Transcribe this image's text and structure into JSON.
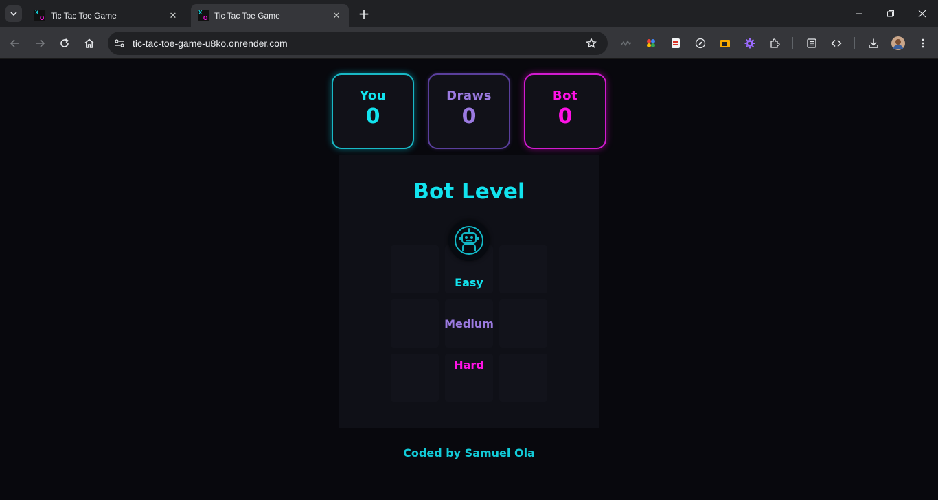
{
  "browser": {
    "tabs": [
      {
        "title": "Tic Tac Toe Game",
        "active": false
      },
      {
        "title": "Tic Tac Toe Game",
        "active": true
      }
    ],
    "url": "tic-tac-toe-game-u8ko.onrender.com"
  },
  "scoreboard": {
    "you": {
      "label": "You",
      "value": "0",
      "color": "#12e3ee"
    },
    "draws": {
      "label": "Draws",
      "value": "0",
      "color": "#9b7ae0"
    },
    "bot": {
      "label": "Bot",
      "value": "0",
      "color": "#ff12e6"
    }
  },
  "level_modal": {
    "title": "Bot Level",
    "icon": "robot-icon",
    "options": [
      {
        "label": "Easy",
        "color": "#12e3ee"
      },
      {
        "label": "Medium",
        "color": "#9b7ae0"
      },
      {
        "label": "Hard",
        "color": "#ff12e6"
      }
    ]
  },
  "footer": {
    "credit": "Coded by Samuel Ola"
  }
}
